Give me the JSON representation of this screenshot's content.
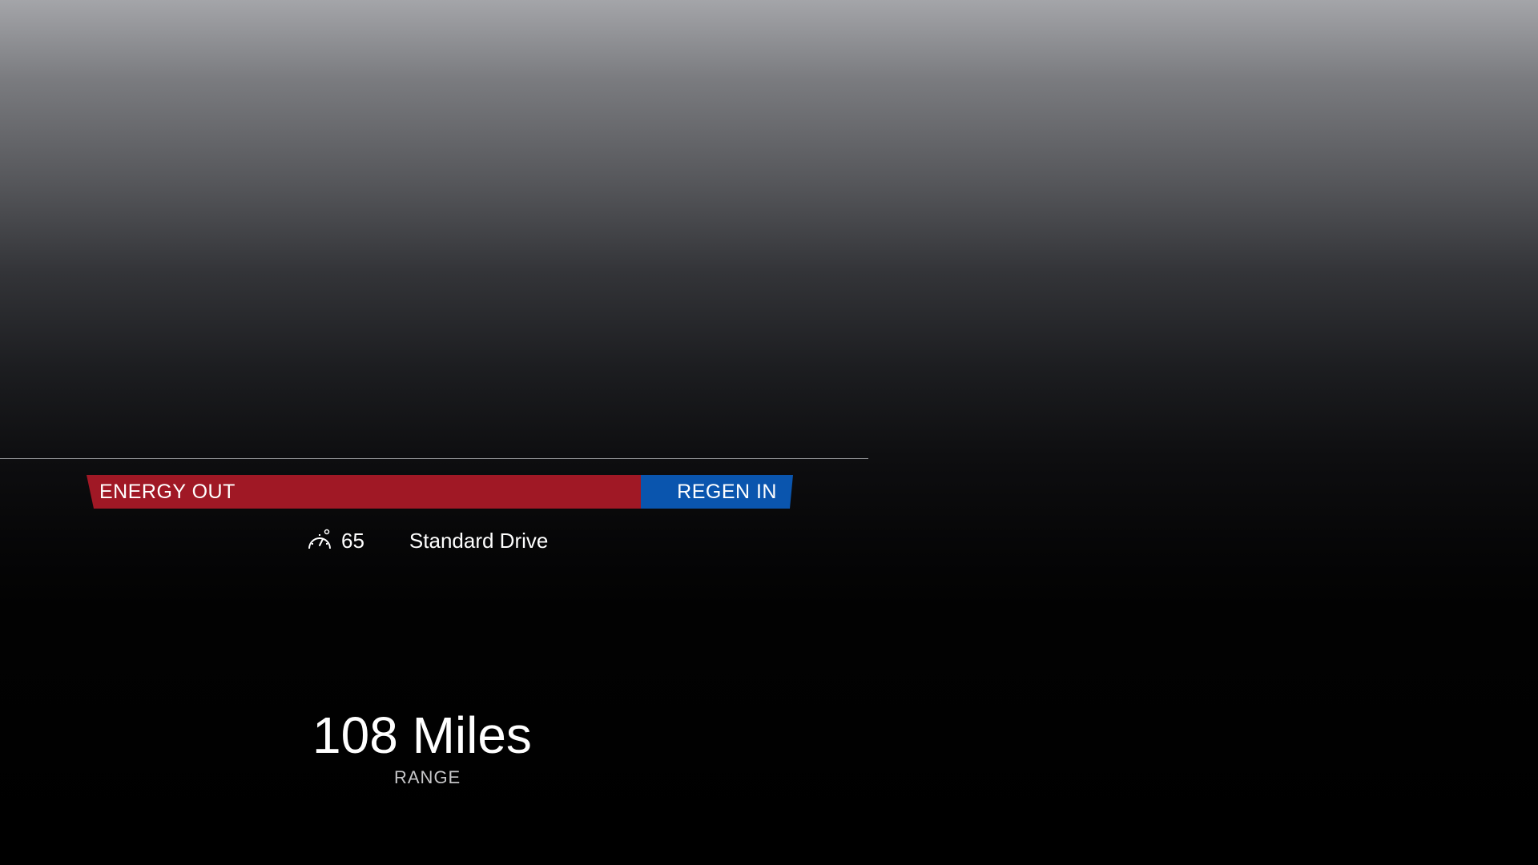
{
  "energy_bar": {
    "out_label": "ENERGY OUT",
    "in_label": "REGEN IN",
    "out_color": "#a01825",
    "in_color": "#0a55ae"
  },
  "status": {
    "speed_icon": "speedometer-icon",
    "speed": "65",
    "drive_mode": "Standard Drive"
  },
  "range": {
    "value": "108 Miles",
    "label": "RANGE"
  },
  "colors": {
    "divider": "#8a8b8e"
  }
}
